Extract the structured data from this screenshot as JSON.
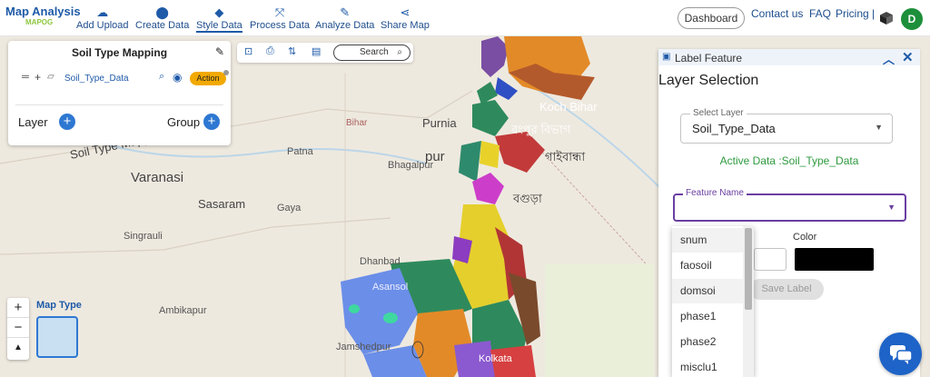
{
  "brand": {
    "title": "Map Analysis",
    "sub_prefix": "MAP",
    "sub_suffix": "OG"
  },
  "nav": [
    {
      "label": "Add Upload",
      "icon": "☁"
    },
    {
      "label": "Create Data",
      "icon": "⬤"
    },
    {
      "label": "Style Data",
      "icon": "◆"
    },
    {
      "label": "Process Data",
      "icon": "⤧"
    },
    {
      "label": "Analyze Data",
      "icon": "✎"
    },
    {
      "label": "Share Map",
      "icon": "⋖"
    }
  ],
  "topright": {
    "dashboard": "Dashboard",
    "contact": "Contact us",
    "faq": "FAQ",
    "pricing": "Pricing |",
    "avatar": "D"
  },
  "left_panel": {
    "title": "Soil Type Mapping",
    "layer_name": "Soil_Type_Data",
    "action": "Action",
    "layer_label": "Layer",
    "group_label": "Group"
  },
  "toolbar": {
    "search": "Search"
  },
  "map": {
    "zoom_in": "+",
    "zoom_out": "−",
    "reset": "▲",
    "map_type": "Map Type",
    "labels": [
      {
        "text": "Soil Type Mapping"
      },
      {
        "text": "Varanasi"
      },
      {
        "text": "Sasaram"
      },
      {
        "text": "Bihar"
      },
      {
        "text": "Patna"
      },
      {
        "text": "Purnia"
      },
      {
        "text": "Bhagalpur"
      },
      {
        "text": "Gaya"
      },
      {
        "text": "Dhanbad"
      },
      {
        "text": "Jamshedpur"
      },
      {
        "text": "Ambikapur"
      },
      {
        "text": "Singrauli"
      },
      {
        "text": "Kolkata"
      },
      {
        "text": "রংপুর বিভাগ"
      },
      {
        "text": "গাইবান্ধা"
      },
      {
        "text": "বগুড়া"
      },
      {
        "text": "Koch Bihar"
      },
      {
        "text": "pur"
      },
      {
        "text": "Asansol"
      }
    ]
  },
  "right_panel": {
    "header": "Label Feature",
    "title": "Layer Selection",
    "select_label": "Select Layer",
    "select_value": "Soil_Type_Data",
    "active": "Active Data :Soil_Type_Data",
    "feature_label": "Feature Name",
    "color_label": "Color",
    "color_value": "#000000",
    "save": "Save Label"
  },
  "dropdown": [
    "snum",
    "faosoil",
    "domsoi",
    "phase1",
    "phase2",
    "misclu1"
  ]
}
